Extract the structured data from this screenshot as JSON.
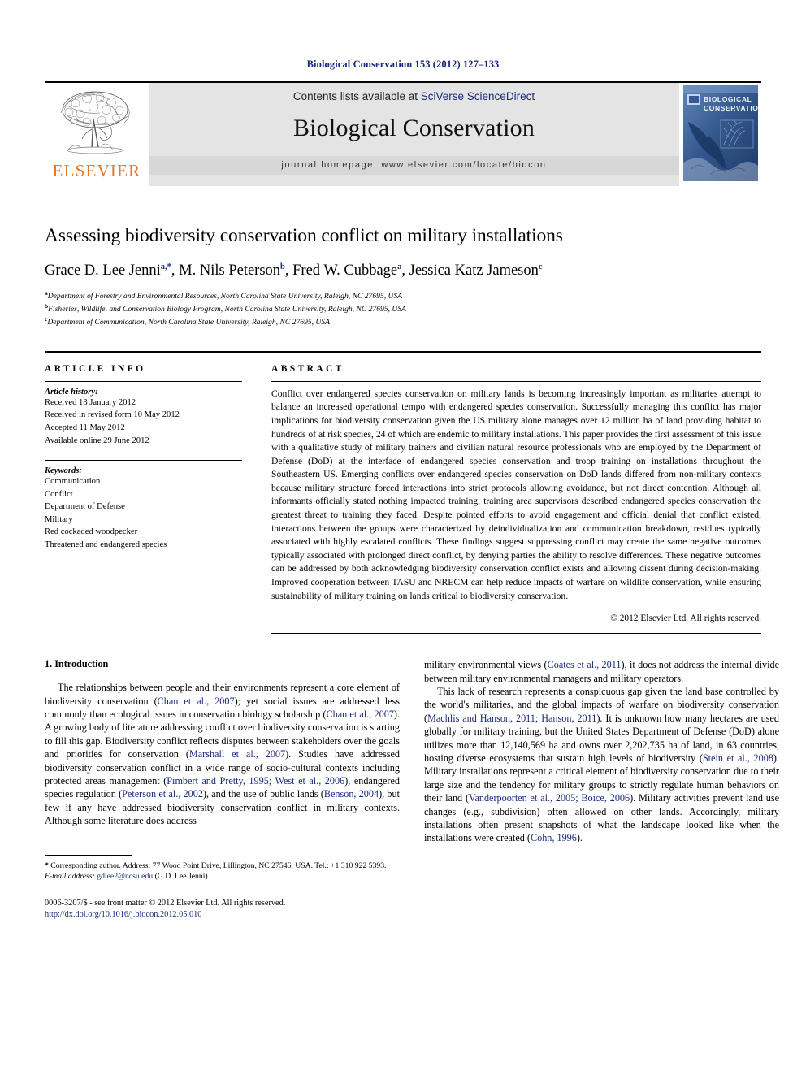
{
  "running_head": "Biological Conservation 153 (2012) 127–133",
  "masthead": {
    "publisher_name": "ELSEVIER",
    "contents_prefix": "Contents lists available at ",
    "contents_link": "SciVerse ScienceDirect",
    "journal_title": "Biological Conservation",
    "homepage_line": "journal homepage: www.elsevier.com/locate/biocon",
    "cover_title_line1": "BIOLOGICAL",
    "cover_title_line2": "CONSERVATION"
  },
  "article": {
    "title": "Assessing biodiversity conservation conflict on military installations",
    "authors": [
      {
        "name": "Grace D. Lee Jenni",
        "marks": "a,*"
      },
      {
        "name": "M. Nils Peterson",
        "marks": "b"
      },
      {
        "name": "Fred W. Cubbage",
        "marks": "a"
      },
      {
        "name": "Jessica Katz Jameson",
        "marks": "c"
      }
    ],
    "affiliations": [
      {
        "mark": "a",
        "text": "Department of Forestry and Environmental Resources, North Carolina State University, Raleigh, NC 27695, USA"
      },
      {
        "mark": "b",
        "text": "Fisheries, Wildlife, and Conservation Biology Program, North Carolina State University, Raleigh, NC 27695, USA"
      },
      {
        "mark": "c",
        "text": "Department of Communication, North Carolina State University, Raleigh, NC 27695, USA"
      }
    ]
  },
  "article_info": {
    "label": "ARTICLE INFO",
    "history_label": "Article history:",
    "history": [
      "Received 13 January 2012",
      "Received in revised form 10 May 2012",
      "Accepted 11 May 2012",
      "Available online 29 June 2012"
    ],
    "keywords_label": "Keywords:",
    "keywords": [
      "Communication",
      "Conflict",
      "Department of Defense",
      "Military",
      "Red cockaded woodpecker",
      "Threatened and endangered species"
    ]
  },
  "abstract": {
    "label": "ABSTRACT",
    "text": "Conflict over endangered species conservation on military lands is becoming increasingly important as militaries attempt to balance an increased operational tempo with endangered species conservation. Successfully managing this conflict has major implications for biodiversity conservation given the US military alone manages over 12 million ha of land providing habitat to hundreds of at risk species, 24 of which are endemic to military installations. This paper provides the first assessment of this issue with a qualitative study of military trainers and civilian natural resource professionals who are employed by the Department of Defense (DoD) at the interface of endangered species conservation and troop training on installations throughout the Southeastern US. Emerging conflicts over endangered species conservation on DoD lands differed from non-military contexts because military structure forced interactions into strict protocols allowing avoidance, but not direct contention. Although all informants officially stated nothing impacted training, training area supervisors described endangered species conservation the greatest threat to training they faced. Despite pointed efforts to avoid engagement and official denial that conflict existed, interactions between the groups were characterized by deindividualization and communication breakdown, residues typically associated with highly escalated conflicts. These findings suggest suppressing conflict may create the same negative outcomes typically associated with prolonged direct conflict, by denying parties the ability to resolve differences. These negative outcomes can be addressed by both acknowledging biodiversity conservation conflict exists and allowing dissent during decision-making. Improved cooperation between TASU and NRECM can help reduce impacts of warfare on wildlife conservation, while ensuring sustainability of military training on lands critical to biodiversity conservation.",
    "copyright": "© 2012 Elsevier Ltd. All rights reserved."
  },
  "introduction": {
    "heading": "1. Introduction",
    "left_paragraph_html": "The relationships between people and their environments represent a core element of biodiversity conservation (<span class=\"link\">Chan et al., 2007</span>); yet social issues are addressed less commonly than ecological issues in conservation biology scholarship (<span class=\"link\">Chan et al., 2007</span>). A growing body of literature addressing conflict over biodiversity conservation is starting to fill this gap. Biodiversity conflict reflects disputes between stakeholders over the goals and priorities for conservation (<span class=\"link\">Marshall et al., 2007</span>). Studies have addressed biodiversity conservation conflict in a wide range of socio-cultural contexts including protected areas management (<span class=\"link\">Pimbert and Pretty, 1995; West et al., 2006</span>), endangered species regulation (<span class=\"link\">Peterson et al., 2002</span>), and the use of public lands (<span class=\"link\">Benson, 2004</span>), but few if any have addressed biodiversity conservation conflict in military contexts. Although some literature does address",
    "right_paragraph_1_html": "military environmental views (<span class=\"link\">Coates et al., 2011</span>), it does not address the internal divide between military environmental managers and military operators.",
    "right_paragraph_2_html": "This lack of research represents a conspicuous gap given the land base controlled by the world's militaries, and the global impacts of warfare on biodiversity conservation (<span class=\"link\">Machlis and Hanson, 2011; Hanson, 2011</span>). It is unknown how many hectares are used globally for military training, but the United States Department of Defense (DoD) alone utilizes more than 12,140,569 ha and owns over 2,202,735 ha of land, in 63 countries, hosting diverse ecosystems that sustain high levels of biodiversity (<span class=\"link\">Stein et al., 2008</span>). Military installations represent a critical element of biodiversity conservation due to their large size and the tendency for military groups to strictly regulate human behaviors on their land (<span class=\"link\">Vanderpoorten et al., 2005; Boice, 2006</span>). Military activities prevent land use changes (e.g., subdivision) often allowed on other lands. Accordingly, military installations often present snapshots of what the landscape looked like when the installations were created (<span class=\"link\">Cohn, 1996</span>)."
  },
  "footnotes": {
    "corresponding_html": "<b>*</b> Corresponding author. Address: 77 Wood Point Drive, Lillington, NC 27546, USA. Tel.: +1 310 922 5393.",
    "email_html": "<i>E-mail address:</i> <span class=\"link\">gdlee2@ncsu.edu</span> (G.D. Lee Jenni).",
    "frontmatter_html": "0006-3207/$ - see front matter © 2012 Elsevier Ltd. All rights reserved.",
    "doi": "http://dx.doi.org/10.1016/j.biocon.2012.05.010"
  },
  "colors": {
    "link": "#1a2a7a",
    "elsevier_orange": "#E87722",
    "band_gray": "#e4e4e4",
    "cover_blue": "#2f5790"
  }
}
